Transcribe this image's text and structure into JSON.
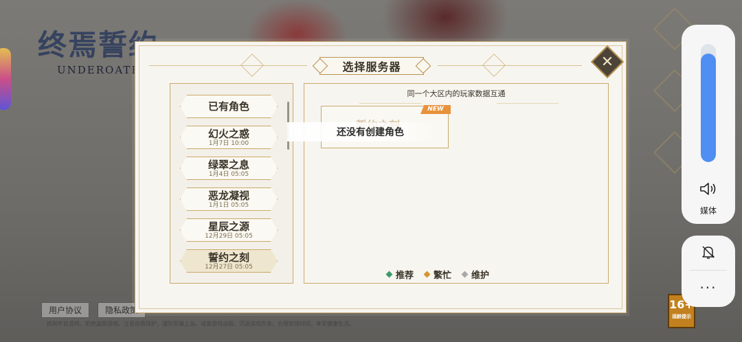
{
  "game": {
    "logo_cn": "终焉誓约",
    "logo_en": "UNDEROATH",
    "bottom_links": [
      "用户协议",
      "隐私政策"
    ],
    "footer_note": "抵制不良游戏，拒绝盗版游戏。注意自我保护，谨防受骗上当。适度游戏益脑，沉迷游戏伤身。合理安排时间，享受健康生活。",
    "age_rating": "16+",
    "age_label": "适龄提示"
  },
  "dialog": {
    "title": "选择服务器",
    "close_icon": "close-icon",
    "hint": "同一个大区内的玩家数据互通",
    "servers": [
      {
        "name": "已有角色",
        "date": ""
      },
      {
        "name": "幻火之惑",
        "date": "1月7日 10:00"
      },
      {
        "name": "绿翠之息",
        "date": "1月4日 05:05"
      },
      {
        "name": "恶龙凝视",
        "date": "1月1日 05:05"
      },
      {
        "name": "星辰之源",
        "date": "12月29日 05:05"
      },
      {
        "name": "誓约之刻",
        "date": "12月27日 05:05"
      }
    ],
    "selected_server": "誓约之刻",
    "card": {
      "faded_name": "誓约之刻",
      "badge": "NEW"
    },
    "tooltip": "还没有创建角色",
    "legend": [
      {
        "label": "推荐",
        "color": "#3a9a6a"
      },
      {
        "label": "繁忙",
        "color": "#d4952f"
      },
      {
        "label": "维护",
        "color": "#a9a9a9"
      }
    ]
  },
  "system": {
    "volume_label": "媒体",
    "volume_level": 0.92,
    "more_label": "···"
  }
}
